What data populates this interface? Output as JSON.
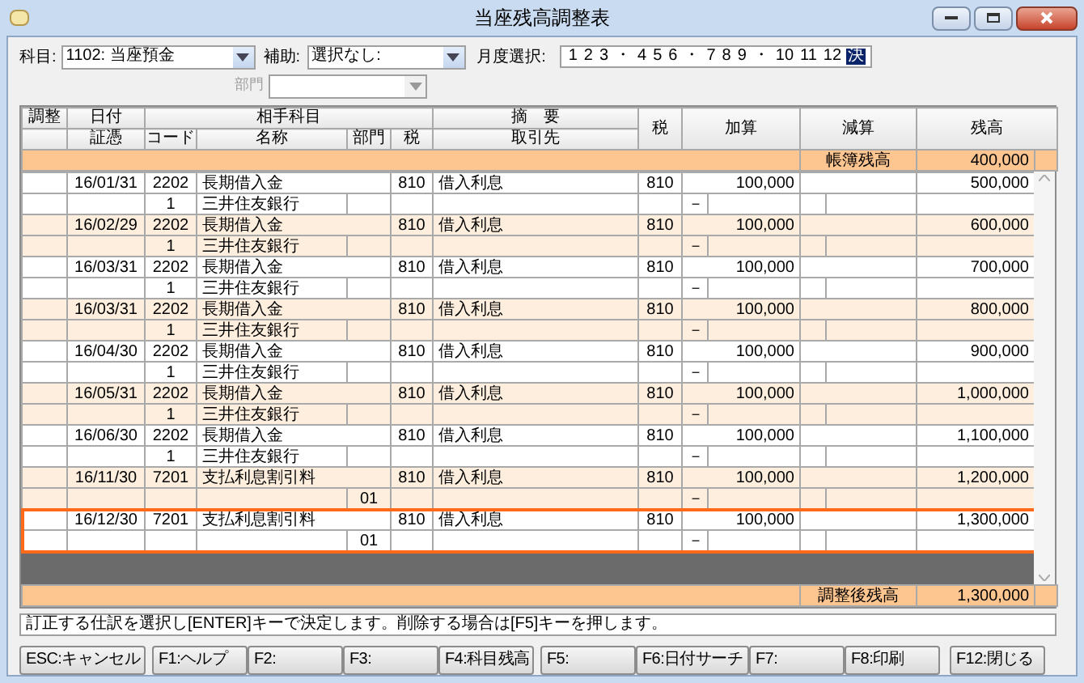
{
  "window": {
    "title": "当座残高調整表"
  },
  "filters": {
    "account": {
      "label": "科目:",
      "value": "1102: 当座預金"
    },
    "sub_account": {
      "label": "補助:",
      "value": "選択なし:"
    },
    "month_label": "月度選択:",
    "months": [
      {
        "label": "1",
        "selected": false
      },
      {
        "label": "2",
        "selected": false
      },
      {
        "label": "3",
        "selected": false
      },
      {
        "label": "・",
        "selected": false
      },
      {
        "label": "4",
        "selected": false
      },
      {
        "label": "5",
        "selected": false
      },
      {
        "label": "6",
        "selected": false
      },
      {
        "label": "・",
        "selected": false
      },
      {
        "label": "7",
        "selected": false
      },
      {
        "label": "8",
        "selected": false
      },
      {
        "label": "9",
        "selected": false
      },
      {
        "label": "・",
        "selected": false
      },
      {
        "label": "10",
        "selected": false
      },
      {
        "label": "11",
        "selected": false
      },
      {
        "label": "12",
        "selected": false
      },
      {
        "label": "決",
        "selected": true
      }
    ],
    "department": {
      "label": "部門",
      "disabled": true
    }
  },
  "table": {
    "headers": {
      "adjust": "調整",
      "date": "日付",
      "voucher": "証憑",
      "counter_account": "相手科目",
      "code": "コード",
      "name": "名称",
      "dept": "部門",
      "tax": "税",
      "summary": "摘　要",
      "partner": "取引先",
      "tax2": "税",
      "add": "加算",
      "subtract": "減算",
      "balance": "残高"
    },
    "opening": {
      "label": "帳簿残高",
      "value": "400,000"
    },
    "rows": [
      {
        "date": "16/01/31",
        "code": "2202",
        "name": "長期借入金",
        "tax": "810",
        "summary": "借入利息",
        "tax2": "810",
        "add": "100,000",
        "balance": "500,000",
        "sub_code": "1",
        "sub_name": "三井住友銀行",
        "sign": "－",
        "selected": false
      },
      {
        "date": "16/02/29",
        "code": "2202",
        "name": "長期借入金",
        "tax": "810",
        "summary": "借入利息",
        "tax2": "810",
        "add": "100,000",
        "balance": "600,000",
        "sub_code": "1",
        "sub_name": "三井住友銀行",
        "sign": "－",
        "selected": false
      },
      {
        "date": "16/03/31",
        "code": "2202",
        "name": "長期借入金",
        "tax": "810",
        "summary": "借入利息",
        "tax2": "810",
        "add": "100,000",
        "balance": "700,000",
        "sub_code": "1",
        "sub_name": "三井住友銀行",
        "sign": "－",
        "selected": false
      },
      {
        "date": "16/03/31",
        "code": "2202",
        "name": "長期借入金",
        "tax": "810",
        "summary": "借入利息",
        "tax2": "810",
        "add": "100,000",
        "balance": "800,000",
        "sub_code": "1",
        "sub_name": "三井住友銀行",
        "sign": "－",
        "selected": false
      },
      {
        "date": "16/04/30",
        "code": "2202",
        "name": "長期借入金",
        "tax": "810",
        "summary": "借入利息",
        "tax2": "810",
        "add": "100,000",
        "balance": "900,000",
        "sub_code": "1",
        "sub_name": "三井住友銀行",
        "sign": "－",
        "selected": false
      },
      {
        "date": "16/05/31",
        "code": "2202",
        "name": "長期借入金",
        "tax": "810",
        "summary": "借入利息",
        "tax2": "810",
        "add": "100,000",
        "balance": "1,000,000",
        "sub_code": "1",
        "sub_name": "三井住友銀行",
        "sign": "－",
        "selected": false
      },
      {
        "date": "16/06/30",
        "code": "2202",
        "name": "長期借入金",
        "tax": "810",
        "summary": "借入利息",
        "tax2": "810",
        "add": "100,000",
        "balance": "1,100,000",
        "sub_code": "1",
        "sub_name": "三井住友銀行",
        "sign": "－",
        "selected": false
      },
      {
        "date": "16/11/30",
        "code": "7201",
        "name": "支払利息割引料",
        "tax": "810",
        "summary": "借入利息",
        "tax2": "810",
        "add": "100,000",
        "balance": "1,200,000",
        "dept": "01",
        "sign": "－",
        "selected": false
      },
      {
        "date": "16/12/30",
        "code": "7201",
        "name": "支払利息割引料",
        "tax": "810",
        "summary": "借入利息",
        "tax2": "810",
        "add": "100,000",
        "balance": "1,300,000",
        "dept": "01",
        "sign": "－",
        "selected": true
      }
    ],
    "closing": {
      "label": "調整後残高",
      "value": "1,300,000"
    }
  },
  "status_message": "訂正する仕訳を選択し[ENTER]キーで決定します。削除する場合は[F5]キーを押します。",
  "function_keys": [
    "ESC:キャンセル",
    "F1:ヘルプ",
    "F2:",
    "F3:",
    "F4:科目残高",
    "F5:",
    "F6:日付サーチ",
    "F7:",
    "F8:印刷",
    "F12:閉じる"
  ]
}
